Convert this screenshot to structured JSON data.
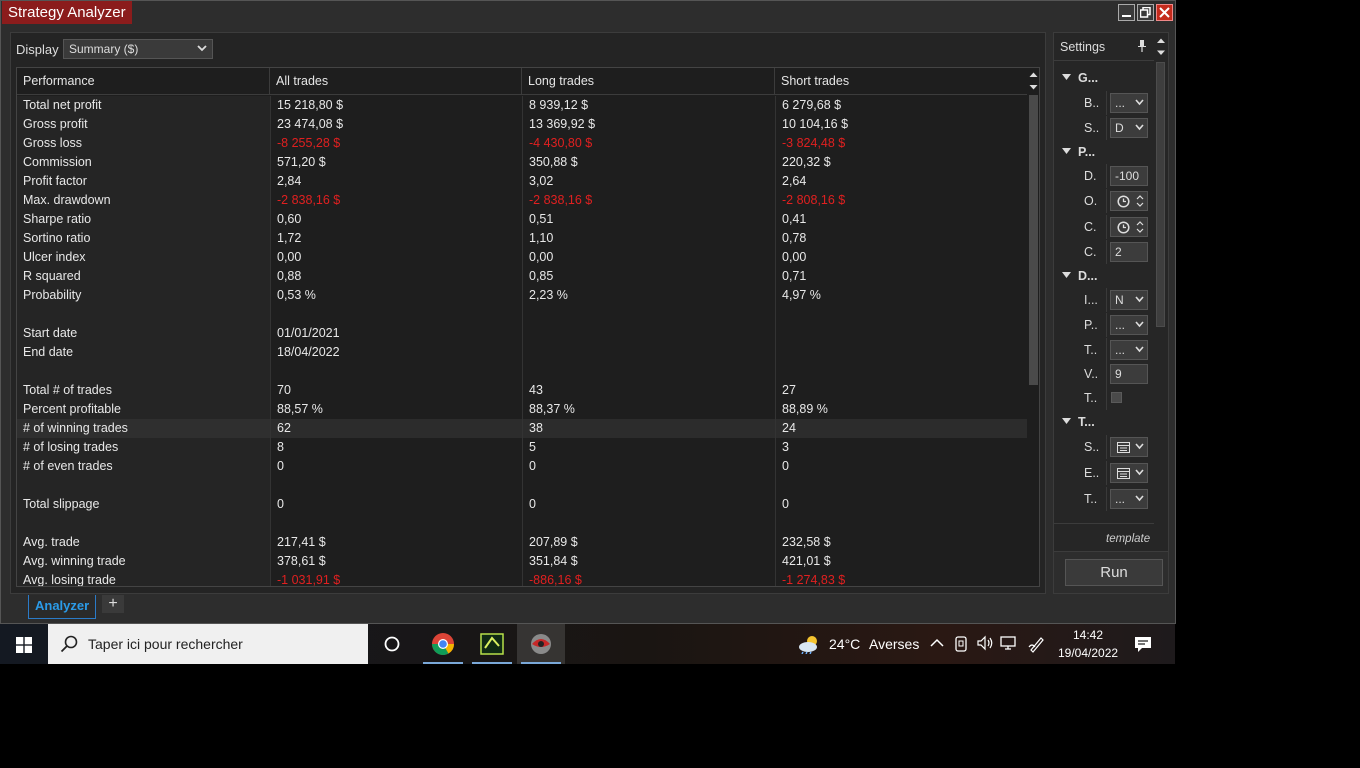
{
  "window": {
    "title": "Strategy Analyzer"
  },
  "display": {
    "label": "Display",
    "value": "Summary ($)"
  },
  "grid": {
    "headers": [
      "Performance",
      "All trades",
      "Long trades",
      "Short trades"
    ],
    "rows": [
      {
        "label": "Total net profit",
        "all": "15 218,80 $",
        "long": "8 939,12 $",
        "short": "6 279,68 $"
      },
      {
        "label": "Gross profit",
        "all": "23 474,08 $",
        "long": "13 369,92 $",
        "short": "10 104,16 $"
      },
      {
        "label": "Gross loss",
        "all": "-8 255,28 $",
        "long": "-4 430,80 $",
        "short": "-3 824,48 $",
        "negative": true
      },
      {
        "label": "Commission",
        "all": "571,20 $",
        "long": "350,88 $",
        "short": "220,32 $"
      },
      {
        "label": "Profit factor",
        "all": "2,84",
        "long": "3,02",
        "short": "2,64"
      },
      {
        "label": "Max. drawdown",
        "all": "-2 838,16 $",
        "long": "-2 838,16 $",
        "short": "-2 808,16 $",
        "negative": true
      },
      {
        "label": "Sharpe ratio",
        "all": "0,60",
        "long": "0,51",
        "short": "0,41"
      },
      {
        "label": "Sortino ratio",
        "all": "1,72",
        "long": "1,10",
        "short": "0,78"
      },
      {
        "label": "Ulcer index",
        "all": "0,00",
        "long": "0,00",
        "short": "0,00"
      },
      {
        "label": "R squared",
        "all": "0,88",
        "long": "0,85",
        "short": "0,71"
      },
      {
        "label": "Probability",
        "all": "0,53 %",
        "long": "2,23 %",
        "short": "4,97 %"
      },
      {
        "label": "",
        "all": "",
        "long": "",
        "short": ""
      },
      {
        "label": "Start date",
        "all": "01/01/2021",
        "long": "",
        "short": ""
      },
      {
        "label": "End date",
        "all": "18/04/2022",
        "long": "",
        "short": ""
      },
      {
        "label": "",
        "all": "",
        "long": "",
        "short": ""
      },
      {
        "label": "Total # of trades",
        "all": "70",
        "long": "43",
        "short": "27"
      },
      {
        "label": "Percent profitable",
        "all": "88,57 %",
        "long": "88,37 %",
        "short": "88,89 %"
      },
      {
        "label": "# of winning trades",
        "all": "62",
        "long": "38",
        "short": "24",
        "highlight": true
      },
      {
        "label": "# of losing trades",
        "all": "8",
        "long": "5",
        "short": "3"
      },
      {
        "label": "# of even trades",
        "all": "0",
        "long": "0",
        "short": "0"
      },
      {
        "label": "",
        "all": "",
        "long": "",
        "short": ""
      },
      {
        "label": "Total slippage",
        "all": "0",
        "long": "0",
        "short": "0"
      },
      {
        "label": "",
        "all": "",
        "long": "",
        "short": ""
      },
      {
        "label": "Avg. trade",
        "all": "217,41 $",
        "long": "207,89 $",
        "short": "232,58 $"
      },
      {
        "label": "Avg. winning trade",
        "all": "378,61 $",
        "long": "351,84 $",
        "short": "421,01 $"
      },
      {
        "label": "Avg. losing trade",
        "all": "-1 031,91 $",
        "long": "-886,16 $",
        "short": "-1 274,83 $",
        "negative": true
      }
    ]
  },
  "settings": {
    "title": "Settings",
    "items": [
      {
        "kind": "group",
        "label": "G..."
      },
      {
        "kind": "select",
        "label": "B..",
        "value": "..."
      },
      {
        "kind": "select",
        "label": "S..",
        "value": "D"
      },
      {
        "kind": "group",
        "label": "P..."
      },
      {
        "kind": "text",
        "label": "D.",
        "value": "-100"
      },
      {
        "kind": "time",
        "label": "O."
      },
      {
        "kind": "time",
        "label": "C."
      },
      {
        "kind": "text",
        "label": "C.",
        "value": "2"
      },
      {
        "kind": "group",
        "label": "D..."
      },
      {
        "kind": "select",
        "label": "I...",
        "value": "N"
      },
      {
        "kind": "select",
        "label": "P..",
        "value": "..."
      },
      {
        "kind": "select",
        "label": "T..",
        "value": "..."
      },
      {
        "kind": "text",
        "label": "V..",
        "value": "9"
      },
      {
        "kind": "check",
        "label": "T.."
      },
      {
        "kind": "group",
        "label": "T..."
      },
      {
        "kind": "date",
        "label": "S.."
      },
      {
        "kind": "date",
        "label": "E.."
      },
      {
        "kind": "select",
        "label": "T..",
        "value": "..."
      }
    ],
    "template_label": "template",
    "run_label": "Run"
  },
  "tabs": {
    "active": "Analyzer",
    "add": "+"
  },
  "taskbar": {
    "search_placeholder": "Taper ici pour rechercher",
    "weather_temp": "24°C",
    "weather_desc": "Averses",
    "time": "14:42",
    "date": "19/04/2022"
  },
  "colors": {
    "negative": "#e02020",
    "accent": "#2b9be8",
    "title_bg": "#8b1c1c"
  }
}
